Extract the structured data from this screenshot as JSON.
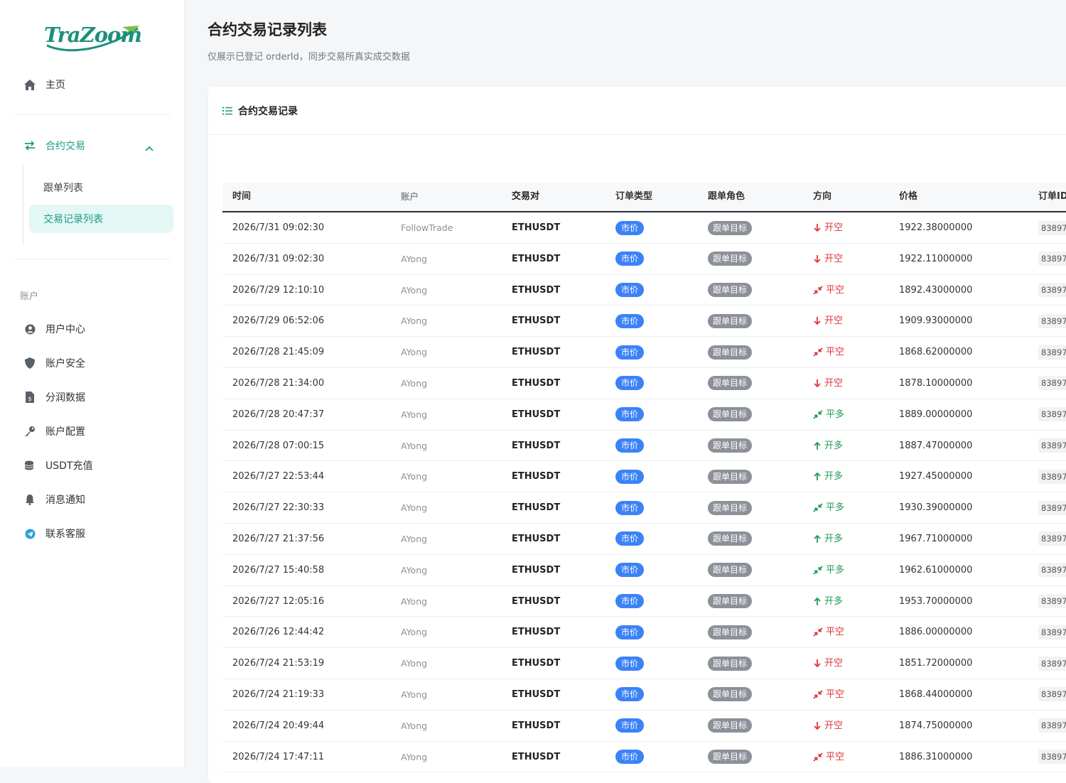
{
  "brand": {
    "logo_text": "TraZoom"
  },
  "sidebar": {
    "home": "主页",
    "contract": {
      "label": "合约交易",
      "children": [
        "跟单列表",
        "交易记录列表"
      ]
    },
    "account_section": "账户",
    "account_items": [
      {
        "label": "用户中心",
        "icon": "user-circle-icon"
      },
      {
        "label": "账户安全",
        "icon": "shield-icon"
      },
      {
        "label": "分润数据",
        "icon": "file-dollar-icon"
      },
      {
        "label": "账户配置",
        "icon": "key-icon"
      },
      {
        "label": "USDT充值",
        "icon": "coins-icon"
      },
      {
        "label": "消息通知",
        "icon": "bell-icon"
      },
      {
        "label": "联系客服",
        "icon": "telegram-icon"
      }
    ]
  },
  "page": {
    "title": "合约交易记录列表",
    "subtitle": "仅展示已登记 orderId，同步交易所真实成交数据"
  },
  "card": {
    "title": "合约交易记录"
  },
  "table": {
    "headers": [
      "时间",
      "账户",
      "交易对",
      "订单类型",
      "跟单角色",
      "方向",
      "价格",
      "订单ID"
    ],
    "rows": [
      {
        "time": "2026/7/31 09:02:30",
        "account": "FollowTrade",
        "pair": "ETHUSDT",
        "type": "市价",
        "role": "跟单目标",
        "direction": "开空",
        "dir_kind": "open-short",
        "price": "1922.38000000",
        "order_id": "83897"
      },
      {
        "time": "2026/7/31 09:02:30",
        "account": "AYong",
        "pair": "ETHUSDT",
        "type": "市价",
        "role": "跟单目标",
        "direction": "开空",
        "dir_kind": "open-short",
        "price": "1922.11000000",
        "order_id": "83897"
      },
      {
        "time": "2026/7/29 12:10:10",
        "account": "AYong",
        "pair": "ETHUSDT",
        "type": "市价",
        "role": "跟单目标",
        "direction": "平空",
        "dir_kind": "close-short",
        "price": "1892.43000000",
        "order_id": "83897"
      },
      {
        "time": "2026/7/29 06:52:06",
        "account": "AYong",
        "pair": "ETHUSDT",
        "type": "市价",
        "role": "跟单目标",
        "direction": "开空",
        "dir_kind": "open-short",
        "price": "1909.93000000",
        "order_id": "83897"
      },
      {
        "time": "2026/7/28 21:45:09",
        "account": "AYong",
        "pair": "ETHUSDT",
        "type": "市价",
        "role": "跟单目标",
        "direction": "平空",
        "dir_kind": "close-short",
        "price": "1868.62000000",
        "order_id": "83897"
      },
      {
        "time": "2026/7/28 21:34:00",
        "account": "AYong",
        "pair": "ETHUSDT",
        "type": "市价",
        "role": "跟单目标",
        "direction": "开空",
        "dir_kind": "open-short",
        "price": "1878.10000000",
        "order_id": "83897"
      },
      {
        "time": "2026/7/28 20:47:37",
        "account": "AYong",
        "pair": "ETHUSDT",
        "type": "市价",
        "role": "跟单目标",
        "direction": "平多",
        "dir_kind": "close-long",
        "price": "1889.00000000",
        "order_id": "83897"
      },
      {
        "time": "2026/7/28 07:00:15",
        "account": "AYong",
        "pair": "ETHUSDT",
        "type": "市价",
        "role": "跟单目标",
        "direction": "开多",
        "dir_kind": "open-long",
        "price": "1887.47000000",
        "order_id": "83897"
      },
      {
        "time": "2026/7/27 22:53:44",
        "account": "AYong",
        "pair": "ETHUSDT",
        "type": "市价",
        "role": "跟单目标",
        "direction": "开多",
        "dir_kind": "open-long",
        "price": "1927.45000000",
        "order_id": "83897"
      },
      {
        "time": "2026/7/27 22:30:33",
        "account": "AYong",
        "pair": "ETHUSDT",
        "type": "市价",
        "role": "跟单目标",
        "direction": "平多",
        "dir_kind": "close-long",
        "price": "1930.39000000",
        "order_id": "83897"
      },
      {
        "time": "2026/7/27 21:37:56",
        "account": "AYong",
        "pair": "ETHUSDT",
        "type": "市价",
        "role": "跟单目标",
        "direction": "开多",
        "dir_kind": "open-long",
        "price": "1967.71000000",
        "order_id": "83897"
      },
      {
        "time": "2026/7/27 15:40:58",
        "account": "AYong",
        "pair": "ETHUSDT",
        "type": "市价",
        "role": "跟单目标",
        "direction": "平多",
        "dir_kind": "close-long",
        "price": "1962.61000000",
        "order_id": "83897"
      },
      {
        "time": "2026/7/27 12:05:16",
        "account": "AYong",
        "pair": "ETHUSDT",
        "type": "市价",
        "role": "跟单目标",
        "direction": "开多",
        "dir_kind": "open-long",
        "price": "1953.70000000",
        "order_id": "83897"
      },
      {
        "time": "2026/7/26 12:44:42",
        "account": "AYong",
        "pair": "ETHUSDT",
        "type": "市价",
        "role": "跟单目标",
        "direction": "平空",
        "dir_kind": "close-short",
        "price": "1886.00000000",
        "order_id": "83897"
      },
      {
        "time": "2026/7/24 21:53:19",
        "account": "AYong",
        "pair": "ETHUSDT",
        "type": "市价",
        "role": "跟单目标",
        "direction": "开空",
        "dir_kind": "open-short",
        "price": "1851.72000000",
        "order_id": "83897"
      },
      {
        "time": "2026/7/24 21:19:33",
        "account": "AYong",
        "pair": "ETHUSDT",
        "type": "市价",
        "role": "跟单目标",
        "direction": "平空",
        "dir_kind": "close-short",
        "price": "1868.44000000",
        "order_id": "83897"
      },
      {
        "time": "2026/7/24 20:49:44",
        "account": "AYong",
        "pair": "ETHUSDT",
        "type": "市价",
        "role": "跟单目标",
        "direction": "开空",
        "dir_kind": "open-short",
        "price": "1874.75000000",
        "order_id": "83897"
      },
      {
        "time": "2026/7/24 17:47:11",
        "account": "AYong",
        "pair": "ETHUSDT",
        "type": "市价",
        "role": "跟单目标",
        "direction": "平空",
        "dir_kind": "close-short",
        "price": "1886.31000000",
        "order_id": "83897"
      }
    ]
  },
  "colors": {
    "accent": "#1c9b86",
    "market_pill": "#3b82f6",
    "role_pill": "#8c9099",
    "short": "#e0353a",
    "long": "#1f9a58"
  }
}
